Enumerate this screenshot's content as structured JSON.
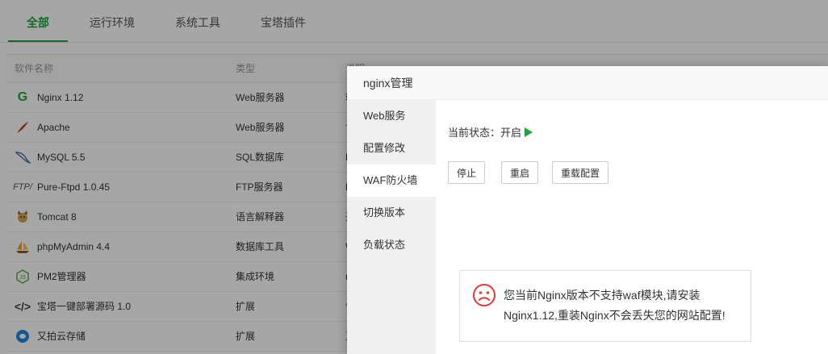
{
  "tabs": {
    "all": "全部",
    "runtime": "运行环境",
    "system_tools": "系统工具",
    "bt_plugins": "宝塔插件"
  },
  "table": {
    "headers": {
      "name": "软件名称",
      "type": "类型",
      "desc": "说明"
    },
    "rows": [
      {
        "name": "Nginx 1.12",
        "type": "Web服务器",
        "desc": "轻",
        "icon": "nginx-icon"
      },
      {
        "name": "Apache",
        "type": "Web服务器",
        "desc": "世",
        "icon": "apache-feather-icon"
      },
      {
        "name": "MySQL 5.5",
        "type": "SQL数据库",
        "desc": "M",
        "icon": "mysql-dolphin-icon"
      },
      {
        "name": "Pure-Ftpd 1.0.45",
        "type": "FTP服务器",
        "desc": "P",
        "icon": "ftp-icon"
      },
      {
        "name": "Tomcat 8",
        "type": "语言解释器",
        "desc": "开",
        "icon": "tomcat-icon"
      },
      {
        "name": "phpMyAdmin 4.4",
        "type": "数据库工具",
        "desc": "W",
        "icon": "phpmyadmin-icon"
      },
      {
        "name": "PM2管理器",
        "type": "集成环境",
        "desc": "n",
        "icon": "nodejs-icon"
      },
      {
        "name": "宝塔一键部署源码 1.0",
        "type": "扩展",
        "desc": "快",
        "icon": "code-icon"
      },
      {
        "name": "又拍云存储",
        "type": "扩展",
        "desc": "又",
        "icon": "upyun-icon"
      }
    ]
  },
  "modal": {
    "title": "nginx管理",
    "menu": [
      "Web服务",
      "配置修改",
      "WAF防火墙",
      "切换版本",
      "负载状态"
    ],
    "status_label": "当前状态：开启",
    "buttons": {
      "stop": "停止",
      "restart": "重启",
      "reload": "重载配置"
    },
    "alert_text": "您当前Nginx版本不支持waf模块,请安装Nginx1.12,重装Nginx不会丢失您的网站配置!"
  },
  "colors": {
    "accent": "#20a53a",
    "alert_icon": "#e53935"
  }
}
